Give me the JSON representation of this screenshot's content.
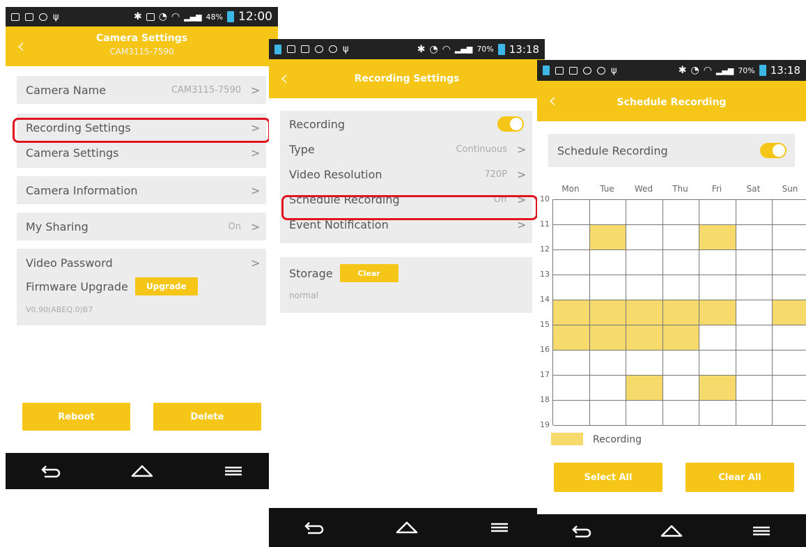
{
  "colors": {
    "accent": "#f5c518",
    "highlight": "#e0141e",
    "cell_on": "#f6da6b"
  },
  "phone1": {
    "status": {
      "battery": "48%",
      "time": "12:00"
    },
    "header": {
      "back_icon": "chevron-left-icon",
      "title": "Camera Settings",
      "subtitle": "CAM3115-7590"
    },
    "rows": {
      "camera_name": {
        "label": "Camera Name",
        "value": "CAM3115-7590"
      },
      "recording_settings": {
        "label": "Recording Settings"
      },
      "camera_settings": {
        "label": "Camera Settings"
      },
      "camera_information": {
        "label": "Camera Information"
      },
      "my_sharing": {
        "label": "My Sharing",
        "value": "On"
      },
      "video_password": {
        "label": "Video Password"
      },
      "firmware": {
        "label": "Firmware Upgrade",
        "button": "Upgrade",
        "version": "V0.90(ABEQ.0)B7"
      }
    },
    "buttons": {
      "reboot": "Reboot",
      "delete": "Delete"
    }
  },
  "phone2": {
    "status": {
      "battery": "70%",
      "time": "13:18"
    },
    "header": {
      "title": "Recording Settings"
    },
    "rows": {
      "recording": {
        "label": "Recording",
        "on": true
      },
      "type": {
        "label": "Type",
        "value": "Continuous"
      },
      "video_resolution": {
        "label": "Video Resolution",
        "value": "720P"
      },
      "schedule_recording": {
        "label": "Schedule Recording",
        "value": "Off"
      },
      "event_notification": {
        "label": "Event Notification"
      }
    },
    "storage": {
      "label": "Storage",
      "button": "Clear",
      "status": "normal"
    }
  },
  "phone3": {
    "status": {
      "battery": "70%",
      "time": "13:18"
    },
    "header": {
      "title": "Schedule Recording"
    },
    "toggle_row": {
      "label": "Schedule Recording",
      "on": true
    },
    "days": [
      "Mon",
      "Tue",
      "Wed",
      "Thu",
      "Fri",
      "Sat",
      "Sun"
    ],
    "hours": [
      "10",
      "11",
      "12",
      "13",
      "14",
      "15",
      "16",
      "17",
      "18",
      "19"
    ],
    "schedule": [
      [
        0,
        0,
        0,
        0,
        0,
        0,
        0
      ],
      [
        0,
        1,
        0,
        0,
        1,
        0,
        0
      ],
      [
        0,
        0,
        0,
        0,
        0,
        0,
        0
      ],
      [
        0,
        0,
        0,
        0,
        0,
        0,
        0
      ],
      [
        1,
        1,
        1,
        1,
        1,
        0,
        1
      ],
      [
        1,
        1,
        1,
        1,
        0,
        0,
        0
      ],
      [
        0,
        0,
        0,
        0,
        0,
        0,
        0
      ],
      [
        0,
        0,
        1,
        0,
        1,
        0,
        0
      ],
      [
        0,
        0,
        0,
        0,
        0,
        0,
        0
      ]
    ],
    "legend": "Recording",
    "buttons": {
      "select_all": "Select All",
      "clear_all": "Clear All"
    }
  },
  "navbar_icons": [
    "back-arrow-icon",
    "home-icon",
    "menu-icon"
  ]
}
